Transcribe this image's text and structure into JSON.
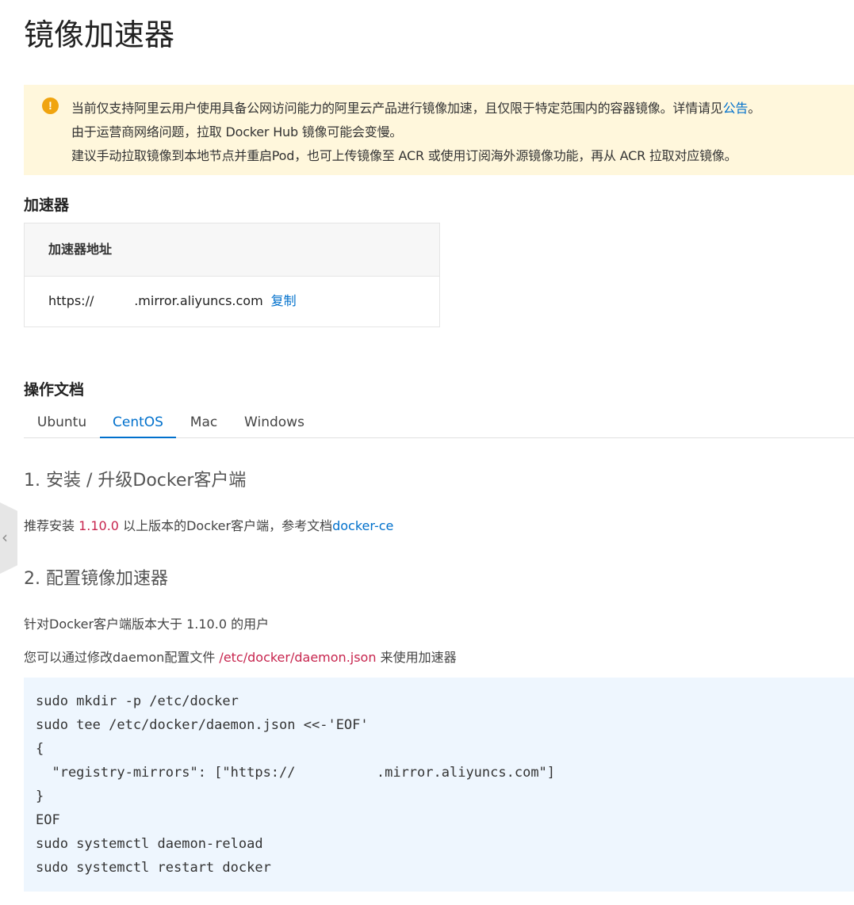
{
  "page": {
    "title": "镜像加速器"
  },
  "notice": {
    "icon": "warning-icon",
    "line1_prefix": "当前仅支持阿里云用户使用具备公网访问能力的阿里云产品进行镜像加速，且仅限于特定范围内的容器镜像。详情请见",
    "line1_link": "公告",
    "line1_suffix": "。",
    "line2": "由于运营商网络问题，拉取 Docker Hub 镜像可能会变慢。",
    "line3": "建议手动拉取镜像到本地节点并重启Pod，也可上传镜像至 ACR 或使用订阅海外源镜像功能，再从 ACR 拉取对应镜像。"
  },
  "accelerator": {
    "section_title": "加速器",
    "column_header": "加速器地址",
    "address": "https://          .mirror.aliyuncs.com",
    "copy_label": "复制"
  },
  "docs": {
    "section_title": "操作文档",
    "tabs": [
      {
        "label": "Ubuntu",
        "active": false
      },
      {
        "label": "CentOS",
        "active": true
      },
      {
        "label": "Mac",
        "active": false
      },
      {
        "label": "Windows",
        "active": false
      }
    ],
    "step1": {
      "heading": "1. 安装 / 升级Docker客户端",
      "text_prefix": "推荐安装 ",
      "version": "1.10.0",
      "text_middle": " 以上版本的Docker客户端，参考文档",
      "link": "docker-ce"
    },
    "step2": {
      "heading": "2. 配置镜像加速器",
      "text1": "针对Docker客户端版本大于 1.10.0 的用户",
      "text2_prefix": "您可以通过修改daemon配置文件 ",
      "config_path": "/etc/docker/daemon.json",
      "text2_suffix": " 来使用加速器",
      "code": "sudo mkdir -p /etc/docker\nsudo tee /etc/docker/daemon.json <<-'EOF'\n{\n  \"registry-mirrors\": [\"https://          .mirror.aliyuncs.com\"]\n}\nEOF\nsudo systemctl daemon-reload\nsudo systemctl restart docker"
    }
  },
  "side_toggle": {
    "icon": "chevron-left-icon"
  },
  "colors": {
    "accent": "#0070cc",
    "warning": "#f0a40f",
    "notice_bg": "#fff7dc",
    "code_bg": "#eef6fe",
    "highlight": "#c7254e"
  }
}
